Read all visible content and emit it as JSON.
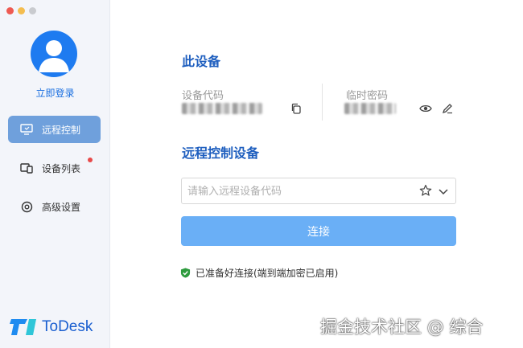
{
  "window": {
    "traffic_lights": [
      "close",
      "minimize",
      "zoom"
    ]
  },
  "sidebar": {
    "login_label": "立即登录",
    "items": [
      {
        "label": "远程控制",
        "icon": "monitor-icon",
        "active": true
      },
      {
        "label": "设备列表",
        "icon": "devices-icon",
        "badge": true
      },
      {
        "label": "高级设置",
        "icon": "settings-icon"
      }
    ],
    "brand": "ToDesk"
  },
  "this_device": {
    "title": "此设备",
    "device_code_label": "设备代码",
    "temp_password_label": "临时密码"
  },
  "remote": {
    "title": "远程控制设备",
    "input_placeholder": "请输入远程设备代码",
    "input_value": "",
    "connect_label": "连接"
  },
  "status": {
    "text": "已准备好连接(端到端加密已启用)"
  },
  "watermark": "掘金技术社区 @ 综合",
  "colors": {
    "accent": "#1f5fbf",
    "active_nav": "#6fa0dc",
    "connect_button": "#6aaff6",
    "status_ok": "#2e9b3e"
  }
}
